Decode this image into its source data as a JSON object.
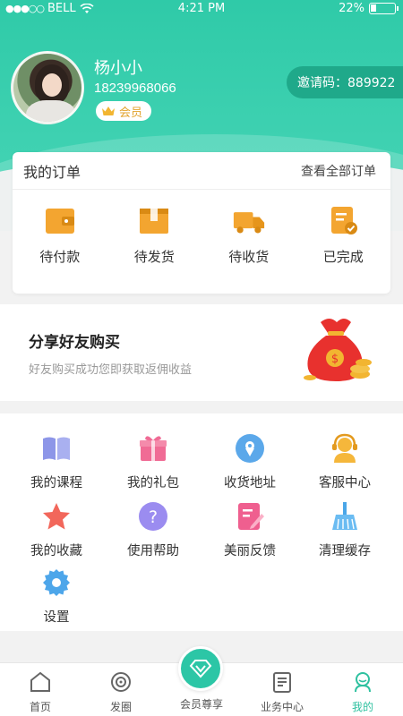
{
  "status": {
    "carrier": "BELL",
    "signal_dots": "●●●○○",
    "time": "4:21 PM",
    "battery": "22%",
    "battery_level": 0.22
  },
  "profile": {
    "name": "杨小小",
    "phone": "18239968066",
    "badge": "会员"
  },
  "invite": {
    "label": "邀请码：889922"
  },
  "orders": {
    "title": "我的订单",
    "view_all": "查看全部订单",
    "items": [
      {
        "label": "待付款",
        "icon": "wallet-icon"
      },
      {
        "label": "待发货",
        "icon": "package-icon"
      },
      {
        "label": "待收货",
        "icon": "truck-icon"
      },
      {
        "label": "已完成",
        "icon": "document-check-icon"
      }
    ]
  },
  "share": {
    "title": "分享好友购买",
    "subtitle": "好友购买成功您即获取返佣收益",
    "icon": "money-bag-icon"
  },
  "services": [
    {
      "label": "我的课程",
      "icon": "book-icon"
    },
    {
      "label": "我的礼包",
      "icon": "gift-icon"
    },
    {
      "label": "收货地址",
      "icon": "location-pin-icon"
    },
    {
      "label": "客服中心",
      "icon": "headset-icon"
    },
    {
      "label": "我的收藏",
      "icon": "star-icon"
    },
    {
      "label": "使用帮助",
      "icon": "question-icon"
    },
    {
      "label": "美丽反馈",
      "icon": "feedback-icon"
    },
    {
      "label": "清理缓存",
      "icon": "broom-icon"
    },
    {
      "label": "设置",
      "icon": "gear-icon"
    }
  ],
  "tabs": [
    {
      "label": "首页",
      "icon": "home-icon"
    },
    {
      "label": "发圈",
      "icon": "circle-icon"
    },
    {
      "label": "会员尊享",
      "icon": "diamond-icon"
    },
    {
      "label": "业务中心",
      "icon": "clipboard-icon"
    },
    {
      "label": "我的",
      "icon": "user-icon"
    }
  ],
  "colors": {
    "primary": "#2fcaa8",
    "accent": "#f3a530",
    "badge_text": "#e2a32d"
  }
}
